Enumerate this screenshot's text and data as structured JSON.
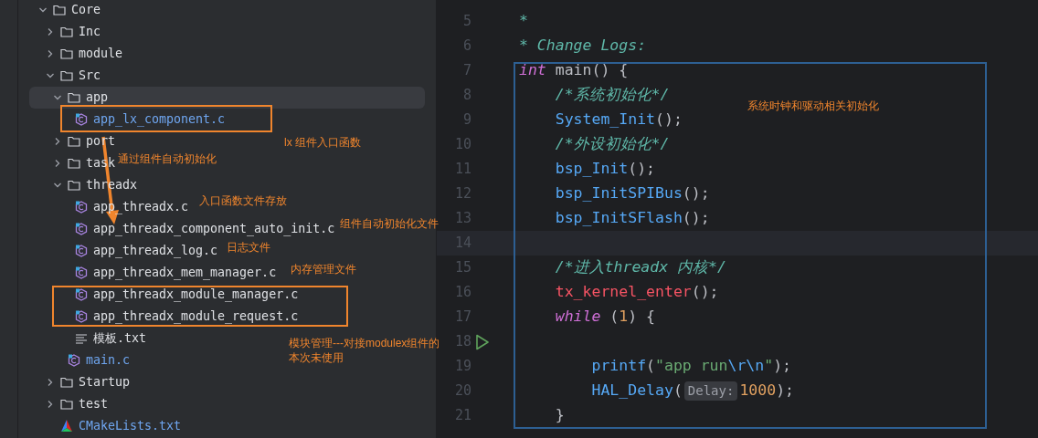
{
  "project_tree": [
    {
      "label": "Core",
      "kind": "folder",
      "expanded": true,
      "selected": false,
      "children": [
        {
          "label": "Inc",
          "kind": "folder",
          "expanded": false,
          "selected": false
        },
        {
          "label": "module",
          "kind": "folder",
          "expanded": false,
          "selected": false
        },
        {
          "label": "Src",
          "kind": "folder",
          "expanded": true,
          "selected": false,
          "children": [
            {
              "label": "app",
              "kind": "folder",
              "expanded": true,
              "selected": true,
              "children": [
                {
                  "label": "app_lx_component.c",
                  "kind": "c_file",
                  "selected": false,
                  "modified": true
                }
              ]
            },
            {
              "label": "port",
              "kind": "folder",
              "expanded": false,
              "selected": false
            },
            {
              "label": "task",
              "kind": "folder",
              "expanded": false,
              "selected": false
            },
            {
              "label": "threadx",
              "kind": "folder",
              "expanded": true,
              "selected": false,
              "children": [
                {
                  "label": "app_threadx.c",
                  "kind": "c_file",
                  "selected": false,
                  "modified": false
                },
                {
                  "label": "app_threadx_component_auto_init.c",
                  "kind": "c_file",
                  "selected": false,
                  "modified": false
                },
                {
                  "label": "app_threadx_log.c",
                  "kind": "c_file",
                  "selected": false,
                  "modified": false
                },
                {
                  "label": "app_threadx_mem_manager.c",
                  "kind": "c_file",
                  "selected": false,
                  "modified": false
                },
                {
                  "label": "app_threadx_module_manager.c",
                  "kind": "c_file",
                  "selected": false,
                  "modified": false
                },
                {
                  "label": "app_threadx_module_request.c",
                  "kind": "c_file",
                  "selected": false,
                  "modified": false
                },
                {
                  "label": "模板.txt",
                  "kind": "text_file",
                  "selected": false,
                  "modified": false
                }
              ]
            },
            {
              "label": "main.c",
              "kind": "c_file",
              "selected": false,
              "modified": true
            }
          ]
        },
        {
          "label": "Startup",
          "kind": "folder",
          "expanded": false,
          "selected": false
        },
        {
          "label": "test",
          "kind": "folder",
          "expanded": false,
          "selected": false
        },
        {
          "label": "CMakeLists.txt",
          "kind": "cmake_file",
          "selected": false,
          "modified": true
        }
      ]
    }
  ],
  "editor": {
    "lines": [
      {
        "number": "5",
        "current": false,
        "run_button": false,
        "tokens": [
          {
            "text": "*",
            "kind": "comment"
          }
        ]
      },
      {
        "number": "6",
        "current": false,
        "run_button": false,
        "tokens": [
          {
            "text": "* Change Logs:",
            "kind": "comment"
          }
        ]
      },
      {
        "number": "7",
        "current": false,
        "run_button": false,
        "tokens": [
          {
            "text": "int",
            "kind": "keyword"
          },
          {
            "text": " main",
            "kind": "plain"
          },
          {
            "text": "() {",
            "kind": "plain"
          }
        ]
      },
      {
        "number": "8",
        "current": false,
        "run_button": false,
        "tokens": [
          {
            "text": "    /*系统初始化*/",
            "kind": "comment"
          }
        ]
      },
      {
        "number": "9",
        "current": false,
        "run_button": false,
        "tokens": [
          {
            "text": "    System_Init",
            "kind": "function"
          },
          {
            "text": "();",
            "kind": "plain"
          }
        ]
      },
      {
        "number": "10",
        "current": false,
        "run_button": false,
        "tokens": [
          {
            "text": "    /*外设初始化*/",
            "kind": "comment"
          }
        ]
      },
      {
        "number": "11",
        "current": false,
        "run_button": false,
        "tokens": [
          {
            "text": "    bsp_Init",
            "kind": "function"
          },
          {
            "text": "();",
            "kind": "plain"
          }
        ]
      },
      {
        "number": "12",
        "current": false,
        "run_button": false,
        "tokens": [
          {
            "text": "    bsp_InitSPIBus",
            "kind": "function"
          },
          {
            "text": "();",
            "kind": "plain"
          }
        ]
      },
      {
        "number": "13",
        "current": false,
        "run_button": false,
        "tokens": [
          {
            "text": "    bsp_InitSFlash",
            "kind": "function"
          },
          {
            "text": "();",
            "kind": "plain"
          }
        ]
      },
      {
        "number": "14",
        "current": true,
        "run_button": false
      },
      {
        "number": "15",
        "current": false,
        "run_button": false,
        "tokens": [
          {
            "text": "    /*进入threadx 内核*/",
            "kind": "comment"
          }
        ]
      },
      {
        "number": "16",
        "current": false,
        "run_button": false,
        "tokens": [
          {
            "text": "    tx_kernel_enter",
            "kind": "macro"
          },
          {
            "text": "();",
            "kind": "plain"
          }
        ]
      },
      {
        "number": "17",
        "current": false,
        "run_button": false,
        "tokens": [
          {
            "text": "    while",
            "kind": "keyword"
          },
          {
            "text": " (",
            "kind": "plain"
          },
          {
            "text": "1",
            "kind": "number"
          },
          {
            "text": ") {",
            "kind": "plain"
          }
        ]
      },
      {
        "number": "18",
        "current": false,
        "run_button": true
      },
      {
        "number": "19",
        "current": false,
        "run_button": false,
        "tokens": [
          {
            "text": "        printf",
            "kind": "function"
          },
          {
            "text": "(",
            "kind": "plain"
          },
          {
            "text": "\"app run",
            "kind": "string"
          },
          {
            "text": "\\r\\n",
            "kind": "escape"
          },
          {
            "text": "\"",
            "kind": "string"
          },
          {
            "text": ");",
            "kind": "plain"
          }
        ]
      },
      {
        "number": "20",
        "current": false,
        "run_button": false,
        "tokens": [
          {
            "text": "        HAL_Delay",
            "kind": "function"
          },
          {
            "text": "(",
            "kind": "plain"
          },
          {
            "text": "Delay:",
            "kind": "hint"
          },
          {
            "text": "1000",
            "kind": "number"
          },
          {
            "text": ");",
            "kind": "plain"
          }
        ]
      },
      {
        "number": "21",
        "current": false,
        "run_button": false,
        "tokens": [
          {
            "text": "    }",
            "kind": "plain"
          }
        ]
      }
    ]
  },
  "annotations": [
    {
      "text": "lx 组件入口函数"
    },
    {
      "text": "通过组件自动初始化"
    },
    {
      "text": "入口函数文件存放"
    },
    {
      "text": "组件自动初始化文件"
    },
    {
      "text": "日志文件"
    },
    {
      "text": "内存管理文件"
    },
    {
      "text": "模块管理---对接modulex组件的"
    },
    {
      "text": "本次未使用"
    },
    {
      "text": "系统时钟和驱动相关初始化"
    }
  ]
}
